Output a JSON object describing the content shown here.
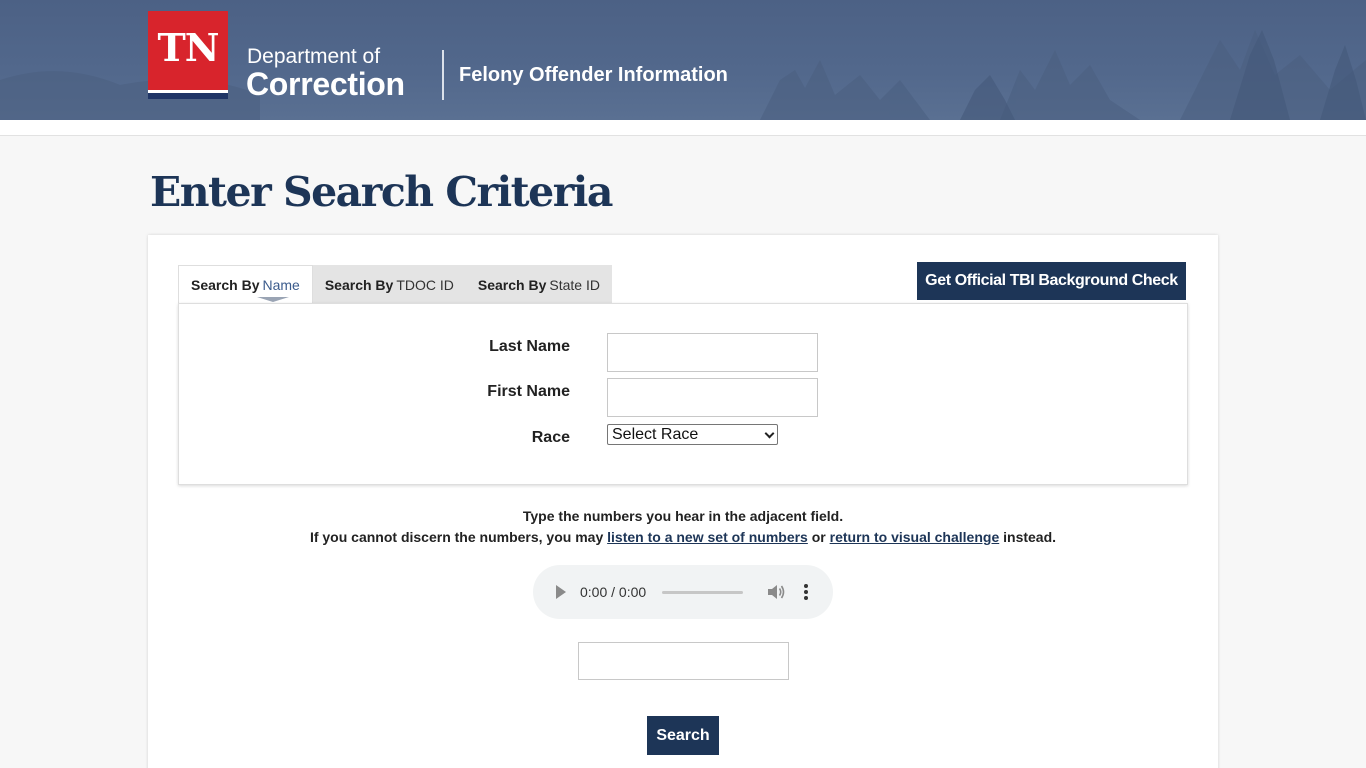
{
  "header": {
    "logo_text": "TN",
    "dept_line1": "Department of",
    "dept_line2": "Correction",
    "site_title": "Felony Offender Information"
  },
  "page": {
    "title": "Enter Search Criteria"
  },
  "tabs": [
    {
      "bold": "Search By",
      "thin": "Name",
      "active": true
    },
    {
      "bold": "Search By",
      "thin": "TDOC ID",
      "active": false
    },
    {
      "bold": "Search By",
      "thin": "State ID",
      "active": false
    }
  ],
  "tbi_button": "Get Official TBI Background Check",
  "form": {
    "last_name_label": "Last Name",
    "last_name_value": "",
    "first_name_label": "First Name",
    "first_name_value": "",
    "race_label": "Race",
    "race_selected": "Select Race"
  },
  "captcha": {
    "instruction": "Type the numbers you hear in the adjacent field.",
    "alt_prefix": "If you cannot discern the numbers, you may",
    "new_set_link": "listen to a new set of numbers",
    "or_text": "or",
    "visual_link": "return to visual challenge",
    "suffix": "instead.",
    "audio_time": "0:00 / 0:00",
    "input_value": ""
  },
  "search_button": "Search",
  "colors": {
    "navy": "#1d3557",
    "logo_red": "#d8242c",
    "header_bg": "#52688c"
  }
}
